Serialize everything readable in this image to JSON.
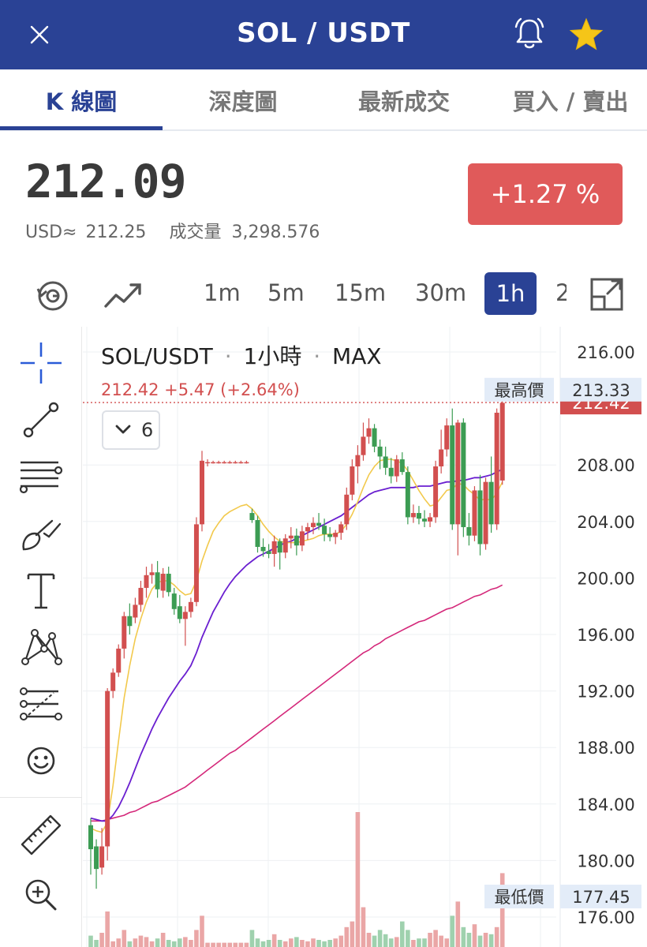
{
  "header": {
    "title": "SOL / USDT",
    "close_icon": "close-icon",
    "bell_icon": "bell-icon",
    "star_icon": "star-icon",
    "star_color": "#f5c518"
  },
  "tabs": [
    {
      "label": "K 線圖",
      "active": true
    },
    {
      "label": "深度圖",
      "active": false
    },
    {
      "label": "最新成交",
      "active": false
    },
    {
      "label": "買入 / 賣出",
      "active": false
    }
  ],
  "ticker": {
    "price": "212.09",
    "usd_label": "USD≈",
    "usd_value": "212.25",
    "volume_label": "成交量",
    "volume_value": "3,298.576",
    "change": "+1.27 %",
    "change_color": "#e05a5a"
  },
  "toolbar": {
    "replay_icon": "replay-icon",
    "indicator_icon": "trend-line-icon",
    "timeframes": [
      "1m",
      "5m",
      "15m",
      "30m",
      "1h",
      "2"
    ],
    "active_timeframe": "1h",
    "fullscreen_icon": "expand-icon"
  },
  "left_tools": [
    "crosshair-icon",
    "line-tool-icon",
    "fib-lines-icon",
    "brush-icon",
    "text-icon",
    "pattern-icon",
    "projection-icon",
    "emoji-icon",
    "ruler-icon",
    "zoom-in-icon"
  ],
  "chart_header": {
    "symbol": "SOL/USDT",
    "interval": "1小時",
    "range": "MAX",
    "ohlc_line": "212.42 +5.47 (+2.64%)",
    "indicators_count": "6"
  },
  "axis": {
    "ticks": [
      "216.00",
      "208.00",
      "204.00",
      "200.00",
      "196.00",
      "192.00",
      "188.00",
      "184.00",
      "180.00",
      "176.00"
    ],
    "high_label": "最高價",
    "high_value": "213.33",
    "low_label": "最低價",
    "low_value": "177.45",
    "current_value": "212.42",
    "up_color": "#d24f4f",
    "down_color": "#3c9c53"
  },
  "chart_data": {
    "type": "candlestick",
    "ylim": [
      175,
      218
    ],
    "candles": [
      [
        182.5,
        183.0,
        179.0,
        180.8
      ],
      [
        181.0,
        181.5,
        178.0,
        179.4
      ],
      [
        179.5,
        182.3,
        179.0,
        181.0
      ],
      [
        181.0,
        192.2,
        180.0,
        192.0
      ],
      [
        192.0,
        193.6,
        191.5,
        193.3
      ],
      [
        193.3,
        195.3,
        193.0,
        195.0
      ],
      [
        195.0,
        197.6,
        194.3,
        197.3
      ],
      [
        197.3,
        198.2,
        196.0,
        196.6
      ],
      [
        197.2,
        198.6,
        196.8,
        198.1
      ],
      [
        198.1,
        199.8,
        197.6,
        199.3
      ],
      [
        199.3,
        200.8,
        198.6,
        200.2
      ],
      [
        200.2,
        201.0,
        199.6,
        200.4
      ],
      [
        200.4,
        201.2,
        198.6,
        199.2
      ],
      [
        199.1,
        200.7,
        198.6,
        200.3
      ],
      [
        200.3,
        200.8,
        198.7,
        199.0
      ],
      [
        198.9,
        199.3,
        197.4,
        197.8
      ],
      [
        198.0,
        198.8,
        196.8,
        197.1
      ],
      [
        197.1,
        198.0,
        195.2,
        197.6
      ],
      [
        197.6,
        198.6,
        197.2,
        198.3
      ],
      [
        198.3,
        204.3,
        198.0,
        203.8
      ],
      [
        203.8,
        209.0,
        203.3,
        208.3
      ],
      [
        208.2,
        208.4,
        207.9,
        208.2
      ],
      [
        208.2,
        208.3,
        208.1,
        208.2
      ],
      [
        208.2,
        208.3,
        208.1,
        208.2
      ],
      [
        208.2,
        208.3,
        208.1,
        208.2
      ],
      [
        208.2,
        208.3,
        208.1,
        208.2
      ],
      [
        208.2,
        208.3,
        208.1,
        208.2
      ],
      [
        208.2,
        208.3,
        208.1,
        208.2
      ],
      [
        208.2,
        208.3,
        208.1,
        208.2
      ],
      [
        204.6,
        204.9,
        203.9,
        204.1
      ],
      [
        204.1,
        204.4,
        201.8,
        202.2
      ],
      [
        202.2,
        202.8,
        201.5,
        201.9
      ],
      [
        201.9,
        202.4,
        201.4,
        201.7
      ],
      [
        201.7,
        203.0,
        200.8,
        202.6
      ],
      [
        202.6,
        202.8,
        200.6,
        201.8
      ],
      [
        201.8,
        203.1,
        201.4,
        202.8
      ],
      [
        202.8,
        203.6,
        202.1,
        203.0
      ],
      [
        203.0,
        203.5,
        201.6,
        202.3
      ],
      [
        202.3,
        203.7,
        201.9,
        203.3
      ],
      [
        203.3,
        203.9,
        202.7,
        203.6
      ],
      [
        203.6,
        204.3,
        203.1,
        203.9
      ],
      [
        203.9,
        204.6,
        203.4,
        203.7
      ],
      [
        203.7,
        204.2,
        202.6,
        203.1
      ],
      [
        203.1,
        203.6,
        202.6,
        202.9
      ],
      [
        202.9,
        203.4,
        202.4,
        203.2
      ],
      [
        203.2,
        204.0,
        202.7,
        203.8
      ],
      [
        203.8,
        206.4,
        203.4,
        205.9
      ],
      [
        205.9,
        208.4,
        205.5,
        207.9
      ],
      [
        207.9,
        209.4,
        206.7,
        208.7
      ],
      [
        208.7,
        211.0,
        208.3,
        210.0
      ],
      [
        210.0,
        211.3,
        209.5,
        210.6
      ],
      [
        210.6,
        210.9,
        208.9,
        209.3
      ],
      [
        209.3,
        209.8,
        207.7,
        208.6
      ],
      [
        208.6,
        209.3,
        207.3,
        207.8
      ],
      [
        207.8,
        208.5,
        206.7,
        207.2
      ],
      [
        207.2,
        208.7,
        206.8,
        208.4
      ],
      [
        208.4,
        208.9,
        207.3,
        207.5
      ],
      [
        207.5,
        207.9,
        203.8,
        204.3
      ],
      [
        204.3,
        205.2,
        203.9,
        204.6
      ],
      [
        204.6,
        205.1,
        203.8,
        204.2
      ],
      [
        204.2,
        204.8,
        203.6,
        204.0
      ],
      [
        204.0,
        204.6,
        203.6,
        204.3
      ],
      [
        204.3,
        208.3,
        203.9,
        207.9
      ],
      [
        207.9,
        210.5,
        207.4,
        209.1
      ],
      [
        209.1,
        211.3,
        208.6,
        210.8
      ],
      [
        210.8,
        212.0,
        203.4,
        203.8
      ],
      [
        203.8,
        211.2,
        201.6,
        211.0
      ],
      [
        211.0,
        211.3,
        202.9,
        203.6
      ],
      [
        203.6,
        204.6,
        202.3,
        203.0
      ],
      [
        203.0,
        206.5,
        202.6,
        206.2
      ],
      [
        206.2,
        207.3,
        201.6,
        202.4
      ],
      [
        202.4,
        207.1,
        202.0,
        206.8
      ],
      [
        206.8,
        208.6,
        203.2,
        203.8
      ],
      [
        203.8,
        212.0,
        203.4,
        211.7
      ],
      [
        206.9,
        213.3,
        206.6,
        212.4
      ]
    ],
    "ma_yellow": [
      182.3,
      182.1,
      182.0,
      182.7,
      185.3,
      188.5,
      191.5,
      193.8,
      195.7,
      197.1,
      198.3,
      199.2,
      199.7,
      199.8,
      199.8,
      199.5,
      199.1,
      198.8,
      198.9,
      199.8,
      201.2,
      202.3,
      203.3,
      203.9,
      204.4,
      204.7,
      204.9,
      205.1,
      205.2,
      204.9,
      204.4,
      203.8,
      203.3,
      202.9,
      202.6,
      202.5,
      202.5,
      202.5,
      202.6,
      202.7,
      202.8,
      203.0,
      203.1,
      203.1,
      203.1,
      203.3,
      203.8,
      204.5,
      205.4,
      206.4,
      207.3,
      207.9,
      208.3,
      208.4,
      208.4,
      208.3,
      208.1,
      207.6,
      206.9,
      206.2,
      205.6,
      205.1,
      205.2,
      205.7,
      206.2,
      206.3,
      206.7,
      206.6,
      206.2,
      205.9,
      205.5,
      205.6,
      205.5,
      206.0,
      206.8
    ],
    "ma_purple": [
      183.0,
      182.9,
      182.8,
      182.8,
      183.2,
      183.8,
      184.6,
      185.5,
      186.5,
      187.5,
      188.4,
      189.3,
      190.1,
      190.8,
      191.5,
      192.1,
      192.7,
      193.2,
      193.8,
      194.7,
      195.8,
      196.7,
      197.6,
      198.3,
      199.0,
      199.6,
      200.1,
      200.5,
      200.9,
      201.2,
      201.5,
      201.7,
      201.9,
      202.1,
      202.3,
      202.5,
      202.6,
      202.8,
      203.0,
      203.2,
      203.4,
      203.6,
      203.8,
      204.0,
      204.2,
      204.4,
      204.7,
      205.0,
      205.3,
      205.6,
      205.9,
      206.1,
      206.2,
      206.3,
      206.4,
      206.4,
      206.4,
      206.4,
      206.4,
      206.5,
      206.5,
      206.5,
      206.6,
      206.7,
      206.8,
      206.8,
      206.9,
      206.9,
      207.0,
      207.1,
      207.1,
      207.2,
      207.3,
      207.5,
      207.7
    ],
    "ma_magenta": [
      182.8,
      182.8,
      182.8,
      182.9,
      183.0,
      183.1,
      183.2,
      183.4,
      183.5,
      183.7,
      183.9,
      184.1,
      184.2,
      184.4,
      184.6,
      184.8,
      185.0,
      185.2,
      185.5,
      185.8,
      186.1,
      186.4,
      186.7,
      187.0,
      187.3,
      187.6,
      187.8,
      188.1,
      188.4,
      188.7,
      189.0,
      189.3,
      189.6,
      189.9,
      190.2,
      190.5,
      190.8,
      191.1,
      191.4,
      191.7,
      192.0,
      192.3,
      192.6,
      192.9,
      193.2,
      193.5,
      193.8,
      194.1,
      194.4,
      194.7,
      194.9,
      195.2,
      195.4,
      195.7,
      195.9,
      196.1,
      196.3,
      196.5,
      196.7,
      196.9,
      197.0,
      197.2,
      197.4,
      197.6,
      197.8,
      197.9,
      198.1,
      198.3,
      198.5,
      198.7,
      198.8,
      199.0,
      199.2,
      199.3,
      199.5
    ],
    "volumes": [
      8,
      5,
      10,
      25,
      4,
      6,
      12,
      4,
      6,
      8,
      7,
      4,
      6,
      10,
      5,
      4,
      6,
      7,
      5,
      12,
      22,
      3,
      3,
      3,
      3,
      3,
      3,
      3,
      3,
      12,
      6,
      4,
      5,
      9,
      5,
      4,
      6,
      7,
      5,
      4,
      6,
      5,
      4,
      5,
      6,
      8,
      14,
      18,
      95,
      28,
      10,
      8,
      12,
      9,
      6,
      7,
      18,
      12,
      5,
      6,
      6,
      10,
      12,
      8,
      6,
      22,
      32,
      14,
      10,
      16,
      8,
      10,
      9,
      14,
      52
    ],
    "legend": []
  }
}
